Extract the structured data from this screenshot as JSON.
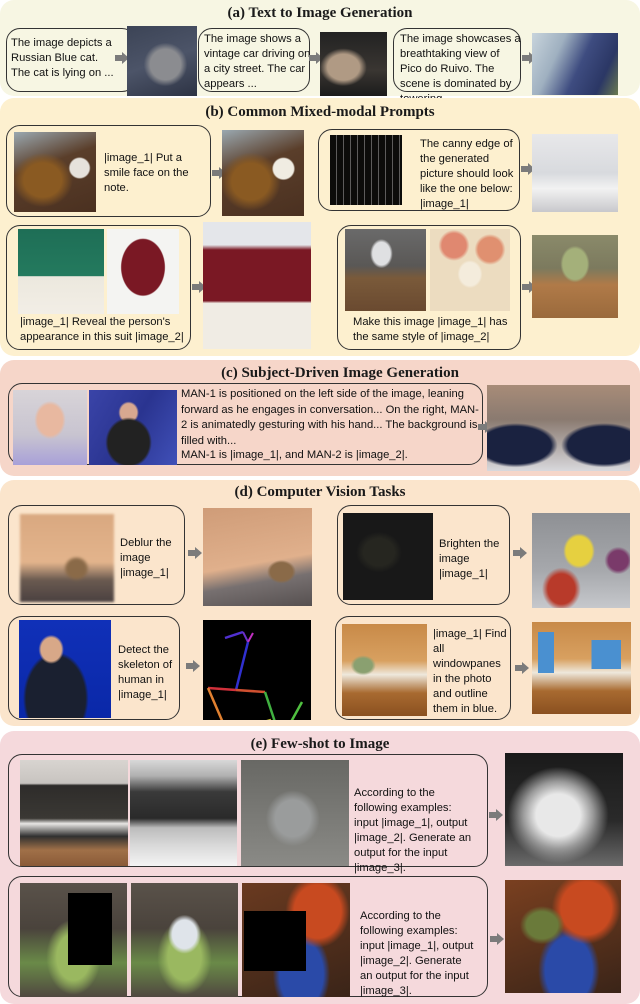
{
  "colors": {
    "section_a_bg": "#f7f6e3",
    "section_b_bg": "#fdf0cf",
    "section_c_bg": "#f6d6c9",
    "section_d_bg": "#fbe5cc",
    "section_e_bg": "#f5d9dc",
    "arrow": "#7b7b7b",
    "box_border": "#333333"
  },
  "sections": {
    "a": {
      "title": "(a) Text to Image Generation",
      "items": [
        {
          "prompt": "The image depicts a Russian Blue cat. The cat is lying on ...",
          "output_image": "cat-photo"
        },
        {
          "prompt": "The image shows a vintage car driving on a city street. The car appears ...",
          "output_image": "vintage-car-photo"
        },
        {
          "prompt": "The image showcases a breathtaking view of Pico do Ruivo. The scene is dominated by towering ...",
          "output_image": "mountain-landscape-photo"
        }
      ]
    },
    "b": {
      "title": "(b) Common Mixed-modal Prompts",
      "items": [
        {
          "prompt": "|image_1| Put a smile face on the note.",
          "input_images": [
            "teddy-bear-note"
          ],
          "output_image": "teddy-bear-smile"
        },
        {
          "prompt": "The canny edge of the generated picture should look like the one below: |image_1|",
          "input_images": [
            "canny-edge-map"
          ],
          "output_image": "walk-in-closet"
        },
        {
          "prompt": "|image_1| Reveal the person's appearance in this suit |image_2|",
          "input_images": [
            "woman-green-blouse",
            "red-sweater"
          ],
          "output_image": "woman-red-sweater"
        },
        {
          "prompt": "Make this image |image_1| has the same style of |image_2|",
          "input_images": [
            "teapot-still-life",
            "tea-cup-illustration"
          ],
          "output_image": "teapot-illustrated"
        }
      ]
    },
    "c": {
      "title": "(c) Subject-Driven Image Generation",
      "prompt_lines": [
        "MAN-1 is positioned on the left side of the image, leaning forward as he engages in conversation... On the right, MAN-2 is animatedly gesturing with his hand... The background is filled with...",
        "MAN-1 is |image_1|, and MAN-2 is |image_2|."
      ],
      "input_images": [
        "man-1-portrait",
        "man-2-speaking"
      ],
      "output_image": "two-men-conversation"
    },
    "d": {
      "title": "(d) Computer Vision Tasks",
      "items": [
        {
          "prompt": "Deblur the image |image_1|",
          "input_images": [
            "blurry-lion-cub"
          ],
          "output_image": "sharp-lion-cub"
        },
        {
          "prompt": "Brighten the image |image_1|",
          "input_images": [
            "dark-toys-scene"
          ],
          "output_image": "bright-toys-scene"
        },
        {
          "prompt": "Detect the skeleton of human in |image_1|",
          "input_images": [
            "man-presenting"
          ],
          "output_image": "pose-skeleton"
        },
        {
          "prompt": "|image_1| Find all windowpanes in the photo and outline them in blue.",
          "input_images": [
            "kitchen-interior"
          ],
          "output_image": "kitchen-windows-blue"
        }
      ]
    },
    "e": {
      "title": "(e) Few-shot to Image",
      "items": [
        {
          "prompt": "According to the following examples: input |image_1|, output |image_2|. Generate an output for the input |image_3|.",
          "input_images": [
            "kitchen-photo",
            "kitchen-depth-map",
            "warrior-character"
          ],
          "output_image": "warrior-depth-map"
        },
        {
          "prompt": "According to the following examples: input |image_1|, output |image_2|. Generate an output for the input |image_3|.",
          "input_images": [
            "rock-arch-masked",
            "rock-arch-filled",
            "armored-figures-masked"
          ],
          "output_image": "armored-figures-filled"
        }
      ]
    }
  }
}
